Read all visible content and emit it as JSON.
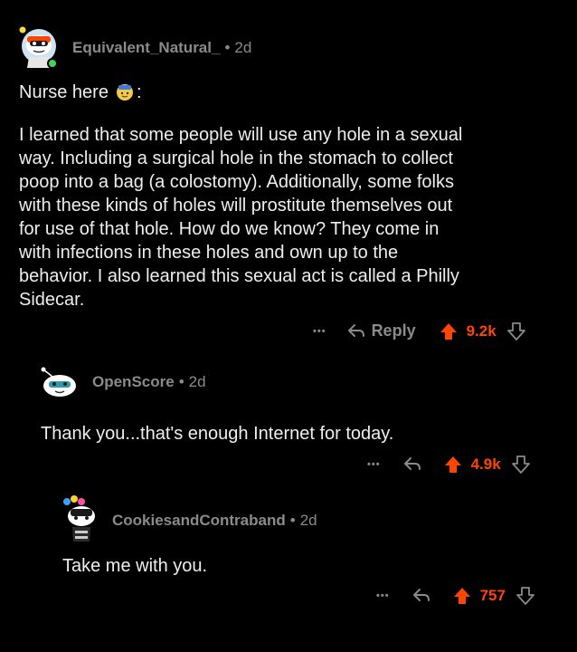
{
  "colors": {
    "background": "#000000",
    "text": "#eeeeee",
    "meta": "#8a8a8a",
    "upvote": "#ff4500",
    "online": "#46d160"
  },
  "comments": [
    {
      "username": "Equivalent_Natural_",
      "separator": "•",
      "time": "2d",
      "intro": "Nurse here",
      "intro_suffix": ":",
      "intro_emoji": "🙋",
      "body_lines": [
        "I learned that some people will use any hole in a sexual",
        "way.  Including a surgical hole in the stomach to collect",
        "poop into a bag (a colostomy).  Additionally, some folks",
        "with these kinds of holes will prostitute themselves out",
        "for use of that hole.  How do we know?  They come in",
        "with infections in these holes and own up to the",
        "behavior.  I also learned this sexual act is called a Philly",
        "Sidecar."
      ],
      "more": "•••",
      "reply_label": "Reply",
      "score": "9.2k",
      "avatar_icon": "snoo-avatar-icon"
    },
    {
      "username": "OpenScore",
      "separator": "•",
      "time": "2d",
      "body": "Thank you...that's enough Internet for today.",
      "more": "•••",
      "score": "4.9k",
      "avatar_icon": "snoo-avatar-icon"
    },
    {
      "username": "CookiesandContraband",
      "separator": "•",
      "time": "2d",
      "body": "Take me with you.",
      "more": "•••",
      "score": "757",
      "avatar_icon": "snoo-avatar-icon"
    }
  ]
}
